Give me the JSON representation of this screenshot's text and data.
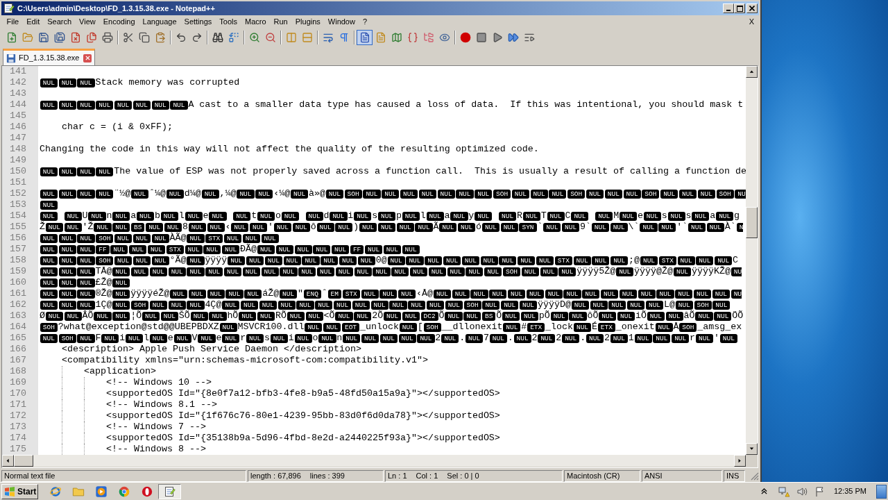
{
  "window": {
    "title": "C:\\Users\\admin\\Desktop\\FD_1.3.15.38.exe - Notepad++"
  },
  "menu": {
    "items": [
      "File",
      "Edit",
      "Search",
      "View",
      "Encoding",
      "Language",
      "Settings",
      "Tools",
      "Macro",
      "Run",
      "Plugins",
      "Window",
      "?"
    ],
    "close_document": "X"
  },
  "toolbar": {
    "groups": [
      {
        "buttons": [
          {
            "kind": "new",
            "pressed": false
          },
          {
            "kind": "open",
            "pressed": false
          },
          {
            "kind": "save",
            "pressed": false
          },
          {
            "kind": "saveall",
            "pressed": false
          },
          {
            "kind": "close",
            "pressed": false
          },
          {
            "kind": "closeall",
            "pressed": false
          },
          {
            "kind": "print",
            "pressed": false
          }
        ]
      },
      {
        "buttons": [
          {
            "kind": "cut",
            "pressed": false
          },
          {
            "kind": "copy",
            "pressed": false
          },
          {
            "kind": "paste",
            "pressed": false
          }
        ]
      },
      {
        "buttons": [
          {
            "kind": "undo",
            "pressed": false
          },
          {
            "kind": "redo",
            "pressed": false
          }
        ]
      },
      {
        "buttons": [
          {
            "kind": "find",
            "pressed": false
          },
          {
            "kind": "replace",
            "pressed": false
          }
        ]
      },
      {
        "buttons": [
          {
            "kind": "zoomin",
            "pressed": false
          },
          {
            "kind": "zoomout",
            "pressed": false
          }
        ]
      },
      {
        "buttons": [
          {
            "kind": "syncv",
            "pressed": false
          },
          {
            "kind": "synch",
            "pressed": false
          }
        ]
      },
      {
        "buttons": [
          {
            "kind": "wrap",
            "pressed": false
          },
          {
            "kind": "allchars",
            "pressed": false
          }
        ]
      },
      {
        "buttons": [
          {
            "kind": "indentguide",
            "pressed": true
          },
          {
            "kind": "language",
            "pressed": false
          },
          {
            "kind": "docmap",
            "pressed": false
          },
          {
            "kind": "functions",
            "pressed": false
          },
          {
            "kind": "workspace",
            "pressed": false
          },
          {
            "kind": "monitor",
            "pressed": false
          }
        ]
      },
      {
        "buttons": [
          {
            "kind": "record",
            "pressed": false
          },
          {
            "kind": "stop",
            "pressed": false
          },
          {
            "kind": "play",
            "pressed": false
          },
          {
            "kind": "playmulti",
            "pressed": false
          },
          {
            "kind": "savemacro",
            "pressed": false
          }
        ]
      }
    ]
  },
  "tabs": [
    {
      "label": "FD_1.3.15.38.exe",
      "selected": true
    }
  ],
  "editor": {
    "lines": [
      {
        "number": "141"
      },
      {
        "number": "142",
        "parts": [
          {
            "kind": "ctrl",
            "codes": [
              "NUL",
              "NUL",
              "NUL"
            ]
          },
          {
            "kind": "text",
            "text": "Stack memory was corrupted"
          }
        ]
      },
      {
        "number": "143"
      },
      {
        "number": "144",
        "parts": [
          {
            "kind": "ctrl",
            "codes": [
              "NUL",
              "NUL",
              "NUL",
              "NUL",
              "NUL",
              "NUL",
              "NUL",
              "NUL"
            ]
          },
          {
            "kind": "text",
            "text": "A cast to a smaller data type has caused a loss of data.  If this was intentional, you should mask t"
          }
        ]
      },
      {
        "number": "145"
      },
      {
        "number": "146",
        "parts": [
          {
            "kind": "text",
            "text": "    char c = (i & 0xFF);"
          }
        ]
      },
      {
        "number": "147"
      },
      {
        "number": "148",
        "parts": [
          {
            "kind": "text",
            "text": "Changing the code in this way will not affect the quality of the resulting optimized code."
          }
        ]
      },
      {
        "number": "149"
      },
      {
        "number": "150",
        "parts": [
          {
            "kind": "ctrl",
            "codes": [
              "NUL",
              "NUL",
              "NUL",
              "NUL"
            ]
          },
          {
            "kind": "text",
            "text": "The value of ESP was not properly saved across a function call.  This is usually a result of calling a function de"
          }
        ]
      },
      {
        "number": "151"
      },
      {
        "number": "152",
        "parts": [
          {
            "kind": "ctrl",
            "codes": [
              "NUL",
              "NUL",
              "NUL",
              "NUL"
            ]
          },
          {
            "kind": "text",
            "text": "¨½@"
          },
          {
            "kind": "ctrl",
            "codes": [
              "NUL"
            ]
          },
          {
            "kind": "text",
            "text": "ˆ¼@"
          },
          {
            "kind": "ctrl",
            "codes": [
              "NUL"
            ]
          },
          {
            "kind": "text",
            "text": "d¼@"
          },
          {
            "kind": "ctrl",
            "codes": [
              "NUL"
            ]
          },
          {
            "kind": "text",
            "text": ",¼@"
          },
          {
            "kind": "ctrl",
            "codes": [
              "NUL",
              "NUL"
            ]
          },
          {
            "kind": "text",
            "text": "‹¼@"
          },
          {
            "kind": "ctrl",
            "codes": [
              "NUL"
            ]
          },
          {
            "kind": "text",
            "text": "à»@"
          },
          {
            "kind": "ctrl",
            "codes": [
              "NUL",
              "SOH",
              "NUL",
              "NUL",
              "NUL",
              "NUL",
              "NUL",
              "NUL",
              "NUL",
              "SOH",
              "NUL",
              "NUL",
              "NUL",
              "SOH",
              "NUL",
              "NUL",
              "NUL",
              "SOH",
              "NUL",
              "NUL",
              "NUL",
              "SOH"
            ]
          },
          {
            "kind": "ctrl_cut",
            "codes": [
              "NU"
            ]
          }
        ]
      },
      {
        "number": "153",
        "parts": [
          {
            "kind": "ctrl",
            "codes": [
              "NUL"
            ]
          }
        ]
      },
      {
        "number": "154",
        "parts": [
          {
            "kind": "ctrl",
            "codes": [
              "NUL"
            ]
          },
          {
            "kind": "space"
          },
          {
            "kind": "ctrl",
            "codes": [
              "NUL"
            ]
          },
          {
            "kind": "text",
            "text": "U"
          },
          {
            "kind": "ctrl",
            "codes": [
              "NUL"
            ]
          },
          {
            "kind": "text",
            "text": "n"
          },
          {
            "kind": "ctrl",
            "codes": [
              "NUL"
            ]
          },
          {
            "kind": "text",
            "text": "a"
          },
          {
            "kind": "ctrl",
            "codes": [
              "NUL"
            ]
          },
          {
            "kind": "text",
            "text": "b"
          },
          {
            "kind": "ctrl",
            "codes": [
              "NUL"
            ]
          },
          {
            "kind": "text",
            "text": "l"
          },
          {
            "kind": "ctrl",
            "codes": [
              "NUL"
            ]
          },
          {
            "kind": "text",
            "text": "e"
          },
          {
            "kind": "ctrl",
            "codes": [
              "NUL"
            ]
          },
          {
            "kind": "space"
          },
          {
            "kind": "ctrl",
            "codes": [
              "NUL"
            ]
          },
          {
            "kind": "text",
            "text": "t"
          },
          {
            "kind": "ctrl",
            "codes": [
              "NUL"
            ]
          },
          {
            "kind": "text",
            "text": "o"
          },
          {
            "kind": "ctrl",
            "codes": [
              "NUL"
            ]
          },
          {
            "kind": "space"
          },
          {
            "kind": "ctrl",
            "codes": [
              "NUL"
            ]
          },
          {
            "kind": "text",
            "text": "d"
          },
          {
            "kind": "ctrl",
            "codes": [
              "NUL"
            ]
          },
          {
            "kind": "text",
            "text": "i"
          },
          {
            "kind": "ctrl",
            "codes": [
              "NUL"
            ]
          },
          {
            "kind": "text",
            "text": "s"
          },
          {
            "kind": "ctrl",
            "codes": [
              "NUL"
            ]
          },
          {
            "kind": "text",
            "text": "p"
          },
          {
            "kind": "ctrl",
            "codes": [
              "NUL"
            ]
          },
          {
            "kind": "text",
            "text": "l"
          },
          {
            "kind": "ctrl",
            "codes": [
              "NUL"
            ]
          },
          {
            "kind": "text",
            "text": "a"
          },
          {
            "kind": "ctrl",
            "codes": [
              "NUL"
            ]
          },
          {
            "kind": "text",
            "text": "y"
          },
          {
            "kind": "ctrl",
            "codes": [
              "NUL"
            ]
          },
          {
            "kind": "space"
          },
          {
            "kind": "ctrl",
            "codes": [
              "NUL"
            ]
          },
          {
            "kind": "text",
            "text": "R"
          },
          {
            "kind": "ctrl",
            "codes": [
              "NUL"
            ]
          },
          {
            "kind": "text",
            "text": "T"
          },
          {
            "kind": "ctrl",
            "codes": [
              "NUL"
            ]
          },
          {
            "kind": "text",
            "text": "C"
          },
          {
            "kind": "ctrl",
            "codes": [
              "NUL"
            ]
          },
          {
            "kind": "space"
          },
          {
            "kind": "ctrl",
            "codes": [
              "NUL"
            ]
          },
          {
            "kind": "text",
            "text": "M"
          },
          {
            "kind": "ctrl",
            "codes": [
              "NUL"
            ]
          },
          {
            "kind": "text",
            "text": "e"
          },
          {
            "kind": "ctrl",
            "codes": [
              "NUL"
            ]
          },
          {
            "kind": "text",
            "text": "s"
          },
          {
            "kind": "ctrl",
            "codes": [
              "NUL"
            ]
          },
          {
            "kind": "text",
            "text": "s"
          },
          {
            "kind": "ctrl",
            "codes": [
              "NUL"
            ]
          },
          {
            "kind": "text",
            "text": "a"
          },
          {
            "kind": "ctrl",
            "codes": [
              "NUL"
            ]
          },
          {
            "kind": "text",
            "text": "g"
          }
        ]
      },
      {
        "number": "155",
        "parts": [
          {
            "kind": "text",
            "text": "Ž"
          },
          {
            "kind": "ctrl",
            "codes": [
              "NUL",
              "NUL"
            ]
          },
          {
            "kind": "text",
            "text": "'Ž"
          },
          {
            "kind": "ctrl",
            "codes": [
              "NUL",
              "NUL",
              "BS",
              "NUL",
              "NUL"
            ]
          },
          {
            "kind": "text",
            "text": "8"
          },
          {
            "kind": "ctrl",
            "codes": [
              "NUL",
              "NUL"
            ]
          },
          {
            "kind": "text",
            "text": "‹"
          },
          {
            "kind": "ctrl",
            "codes": [
              "NUL",
              "NUL"
            ]
          },
          {
            "kind": "text",
            "text": "'"
          },
          {
            "kind": "ctrl",
            "codes": [
              "NUL",
              "NUL"
            ]
          },
          {
            "kind": "text",
            "text": "ô"
          },
          {
            "kind": "ctrl",
            "codes": [
              "NUL",
              "NUL"
            ]
          },
          {
            "kind": "text",
            "text": ")"
          },
          {
            "kind": "ctrl",
            "codes": [
              "NUL",
              "NUL",
              "NUL",
              "NUL"
            ]
          },
          {
            "kind": "text",
            "text": "Ã"
          },
          {
            "kind": "ctrl",
            "codes": [
              "NUL",
              "NUL"
            ]
          },
          {
            "kind": "text",
            "text": "ó"
          },
          {
            "kind": "ctrl",
            "codes": [
              "NUL",
              "NUL",
              "SYN"
            ]
          },
          {
            "kind": "text",
            "text": "`"
          },
          {
            "kind": "ctrl",
            "codes": [
              "NUL",
              "NUL"
            ]
          },
          {
            "kind": "text",
            "text": "9`"
          },
          {
            "kind": "ctrl",
            "codes": [
              "NUL",
              "NUL"
            ]
          },
          {
            "kind": "text",
            "text": "\\`"
          },
          {
            "kind": "ctrl",
            "codes": [
              "NUL",
              "NUL"
            ]
          },
          {
            "kind": "text",
            "text": "'`"
          },
          {
            "kind": "ctrl",
            "codes": [
              "NUL",
              "NUL"
            ]
          },
          {
            "kind": "text",
            "text": "À`"
          },
          {
            "kind": "ctrl_cut",
            "codes": [
              "N"
            ]
          }
        ]
      },
      {
        "number": "156",
        "parts": [
          {
            "kind": "ctrl",
            "codes": [
              "NUL",
              "NUL",
              "NUL",
              "SOH",
              "NUL",
              "NUL",
              "NUL"
            ]
          },
          {
            "kind": "text",
            "text": "ÀÃ@"
          },
          {
            "kind": "ctrl",
            "codes": [
              "NUL",
              "STX",
              "NUL",
              "NUL",
              "NUL"
            ]
          }
        ]
      },
      {
        "number": "157",
        "parts": [
          {
            "kind": "ctrl",
            "codes": [
              "NUL",
              "NUL",
              "NUL",
              "FF",
              "NUL",
              "NUL",
              "NUL",
              "STX",
              "NUL",
              "NUL",
              "NUL"
            ]
          },
          {
            "kind": "text",
            "text": "ÐÃ@"
          },
          {
            "kind": "ctrl",
            "codes": [
              "NUL",
              "NUL",
              "NUL",
              "NUL",
              "NUL",
              "FF",
              "NUL",
              "NUL",
              "NUL"
            ]
          }
        ]
      },
      {
        "number": "158",
        "parts": [
          {
            "kind": "ctrl",
            "codes": [
              "NUL",
              "NUL",
              "NUL",
              "SOH",
              "NUL",
              "NUL",
              "NUL"
            ]
          },
          {
            "kind": "text",
            "text": "°Ã@"
          },
          {
            "kind": "ctrl",
            "codes": [
              "NUL"
            ]
          },
          {
            "kind": "text",
            "text": "ÿÿÿÿ"
          },
          {
            "kind": "ctrl",
            "codes": [
              "NUL",
              "NUL",
              "NUL",
              "NUL",
              "NUL",
              "NUL",
              "NUL",
              "NUL"
            ]
          },
          {
            "kind": "text",
            "text": "0@"
          },
          {
            "kind": "ctrl",
            "codes": [
              "NUL",
              "NUL",
              "NUL",
              "NUL",
              "NUL",
              "NUL",
              "NUL",
              "NUL",
              "NUL",
              "STX",
              "NUL",
              "NUL",
              "NUL"
            ]
          },
          {
            "kind": "text",
            "text": ";@"
          },
          {
            "kind": "ctrl",
            "codes": [
              "NUL",
              "STX",
              "NUL",
              "NUL",
              "NUL"
            ]
          },
          {
            "kind": "text",
            "text": "C"
          }
        ]
      },
      {
        "number": "159",
        "parts": [
          {
            "kind": "ctrl",
            "codes": [
              "NUL",
              "NUL",
              "NUL"
            ]
          },
          {
            "kind": "text",
            "text": "TÅ@"
          },
          {
            "kind": "ctrl",
            "codes": [
              "NUL",
              "NUL",
              "NUL",
              "NUL",
              "NUL",
              "NUL",
              "NUL",
              "NUL",
              "NUL",
              "NUL",
              "NUL",
              "NUL",
              "NUL",
              "NUL",
              "NUL",
              "NUL",
              "NUL",
              "NUL",
              "NUL",
              "NUL",
              "NUL",
              "SOH",
              "NUL",
              "NUL",
              "NUL"
            ]
          },
          {
            "kind": "text",
            "text": "ÿÿÿÿ5Ž@"
          },
          {
            "kind": "ctrl",
            "codes": [
              "NUL"
            ]
          },
          {
            "kind": "text",
            "text": "ÿÿÿÿ@Ž@"
          },
          {
            "kind": "ctrl",
            "codes": [
              "NUL"
            ]
          },
          {
            "kind": "text",
            "text": "ÿÿÿÿKŽ@"
          },
          {
            "kind": "ctrl_cut",
            "codes": [
              "NU"
            ]
          }
        ]
      },
      {
        "number": "160",
        "parts": [
          {
            "kind": "ctrl",
            "codes": [
              "NUL",
              "NUL",
              "NUL"
            ]
          },
          {
            "kind": "text",
            "text": "£Ž@"
          },
          {
            "kind": "ctrl",
            "codes": [
              "NUL"
            ]
          }
        ]
      },
      {
        "number": "161",
        "parts": [
          {
            "kind": "ctrl",
            "codes": [
              "NUL",
              "NUL",
              "NUL"
            ]
          },
          {
            "kind": "text",
            "text": "®Ž@"
          },
          {
            "kind": "ctrl",
            "codes": [
              "NUL"
            ]
          },
          {
            "kind": "text",
            "text": "ÿÿÿÿéŽ@"
          },
          {
            "kind": "ctrl",
            "codes": [
              "NUL",
              "NUL",
              "NUL",
              "NUL",
              "NUL"
            ]
          },
          {
            "kind": "text",
            "text": "áŽ@"
          },
          {
            "kind": "ctrl",
            "codes": [
              "NUL"
            ]
          },
          {
            "kind": "text",
            "text": "\""
          },
          {
            "kind": "ctrl",
            "codes": [
              "ENQ"
            ]
          },
          {
            "kind": "text",
            "text": "ˆ"
          },
          {
            "kind": "ctrl",
            "codes": [
              "EM",
              "STX",
              "NUL",
              "NUL",
              "NUL"
            ]
          },
          {
            "kind": "text",
            "text": "‹Å@"
          },
          {
            "kind": "ctrl",
            "codes": [
              "NUL",
              "NUL",
              "NUL",
              "NUL",
              "NUL",
              "NUL",
              "NUL",
              "NUL",
              "NUL",
              "NUL",
              "NUL",
              "NUL",
              "NUL",
              "NUL",
              "NUL",
              "NUL"
            ]
          },
          {
            "kind": "ctrl_cut",
            "codes": [
              "NU"
            ]
          }
        ]
      },
      {
        "number": "162",
        "parts": [
          {
            "kind": "ctrl",
            "codes": [
              "NUL",
              "NUL",
              "NUL"
            ]
          },
          {
            "kind": "text",
            "text": "1Ç@"
          },
          {
            "kind": "ctrl",
            "codes": [
              "NUL",
              "SOH",
              "NUL",
              "NUL",
              "NUL"
            ]
          },
          {
            "kind": "text",
            "text": "4Ç@"
          },
          {
            "kind": "ctrl",
            "codes": [
              "NUL",
              "NUL",
              "NUL",
              "NUL",
              "NUL",
              "NUL",
              "NUL",
              "NUL",
              "NUL",
              "NUL",
              "NUL",
              "NUL",
              "NUL",
              "SOH",
              "NUL",
              "NUL",
              "NUL"
            ]
          },
          {
            "kind": "text",
            "text": "ÿÿÿÿD@"
          },
          {
            "kind": "ctrl",
            "codes": [
              "NUL",
              "NUL",
              "NUL",
              "NUL",
              "NUL"
            ]
          },
          {
            "kind": "text",
            "text": "L@"
          },
          {
            "kind": "ctrl",
            "codes": [
              "NUL",
              "SOH",
              "NUL"
            ]
          }
        ]
      },
      {
        "number": "163",
        "parts": [
          {
            "kind": "text",
            "text": "Ø"
          },
          {
            "kind": "ctrl",
            "codes": [
              "NUL",
              "NUL"
            ]
          },
          {
            "kind": "text",
            "text": "ÂÕ"
          },
          {
            "kind": "ctrl",
            "codes": [
              "NUL",
              "NUL"
            ]
          },
          {
            "kind": "text",
            "text": "¦Õ"
          },
          {
            "kind": "ctrl",
            "codes": [
              "NUL",
              "NUL"
            ]
          },
          {
            "kind": "text",
            "text": "ŠÕ"
          },
          {
            "kind": "ctrl",
            "codes": [
              "NUL",
              "NUL"
            ]
          },
          {
            "kind": "text",
            "text": "hÕ"
          },
          {
            "kind": "ctrl",
            "codes": [
              "NUL",
              "NUL"
            ]
          },
          {
            "kind": "text",
            "text": "RÕ"
          },
          {
            "kind": "ctrl",
            "codes": [
              "NUL",
              "NUL"
            ]
          },
          {
            "kind": "text",
            "text": "<Õ"
          },
          {
            "kind": "ctrl",
            "codes": [
              "NUL",
              "NUL"
            ]
          },
          {
            "kind": "text",
            "text": "2Õ"
          },
          {
            "kind": "ctrl",
            "codes": [
              "NUL",
              "NUL",
              "DC2"
            ]
          },
          {
            "kind": "text",
            "text": "Õ"
          },
          {
            "kind": "ctrl",
            "codes": [
              "NUL",
              "NUL",
              "BS"
            ]
          },
          {
            "kind": "text",
            "text": "Õ"
          },
          {
            "kind": "ctrl",
            "codes": [
              "NUL",
              "NUL"
            ]
          },
          {
            "kind": "text",
            "text": "pÕ"
          },
          {
            "kind": "ctrl",
            "codes": [
              "NUL",
              "NUL"
            ]
          },
          {
            "kind": "text",
            "text": "ôÕ"
          },
          {
            "kind": "ctrl",
            "codes": [
              "NUL",
              "NUL"
            ]
          },
          {
            "kind": "text",
            "text": "iÕ"
          },
          {
            "kind": "ctrl",
            "codes": [
              "NUL",
              "NUL"
            ]
          },
          {
            "kind": "text",
            "text": "âÕ"
          },
          {
            "kind": "ctrl",
            "codes": [
              "NUL",
              "NUL"
            ]
          },
          {
            "kind": "text",
            "text": "ÖÕ"
          }
        ]
      },
      {
        "number": "164",
        "parts": [
          {
            "kind": "ctrl",
            "codes": [
              "SOH"
            ]
          },
          {
            "kind": "text",
            "text": "?what@exception@std@@UBEPBDXZ"
          },
          {
            "kind": "ctrl",
            "codes": [
              "NUL"
            ]
          },
          {
            "kind": "text",
            "text": "MSVCR100.dll"
          },
          {
            "kind": "ctrl",
            "codes": [
              "NUL",
              "NUL",
              "EOT"
            ]
          },
          {
            "kind": "text",
            "text": "_unlock"
          },
          {
            "kind": "ctrl",
            "codes": [
              "NUL"
            ]
          },
          {
            "kind": "text",
            "text": "["
          },
          {
            "kind": "ctrl",
            "codes": [
              "SOH"
            ]
          },
          {
            "kind": "text",
            "text": "__dllonexit"
          },
          {
            "kind": "ctrl",
            "codes": [
              "NUL"
            ]
          },
          {
            "kind": "text",
            "text": "#"
          },
          {
            "kind": "ctrl",
            "codes": [
              "ETX"
            ]
          },
          {
            "kind": "text",
            "text": "_lock"
          },
          {
            "kind": "ctrl",
            "codes": [
              "NUL"
            ]
          },
          {
            "kind": "text",
            "text": "É"
          },
          {
            "kind": "ctrl",
            "codes": [
              "ETX"
            ]
          },
          {
            "kind": "text",
            "text": "_onexit"
          },
          {
            "kind": "ctrl",
            "codes": [
              "NUL"
            ]
          },
          {
            "kind": "text",
            "text": "Å"
          },
          {
            "kind": "ctrl",
            "codes": [
              "SOH"
            ]
          },
          {
            "kind": "text",
            "text": "_amsg_ex"
          }
        ]
      },
      {
        "number": "165",
        "parts": [
          {
            "kind": "ctrl",
            "codes": [
              "NUL",
              "SOH",
              "NUL"
            ]
          },
          {
            "kind": "text",
            "text": "F"
          },
          {
            "kind": "ctrl",
            "codes": [
              "NUL"
            ]
          },
          {
            "kind": "text",
            "text": "i"
          },
          {
            "kind": "ctrl",
            "codes": [
              "NUL"
            ]
          },
          {
            "kind": "text",
            "text": "l"
          },
          {
            "kind": "ctrl",
            "codes": [
              "NUL"
            ]
          },
          {
            "kind": "text",
            "text": "e"
          },
          {
            "kind": "ctrl",
            "codes": [
              "NUL"
            ]
          },
          {
            "kind": "text",
            "text": "V"
          },
          {
            "kind": "ctrl",
            "codes": [
              "NUL"
            ]
          },
          {
            "kind": "text",
            "text": "e"
          },
          {
            "kind": "ctrl",
            "codes": [
              "NUL"
            ]
          },
          {
            "kind": "text",
            "text": "r"
          },
          {
            "kind": "ctrl",
            "codes": [
              "NUL"
            ]
          },
          {
            "kind": "text",
            "text": "s"
          },
          {
            "kind": "ctrl",
            "codes": [
              "NUL"
            ]
          },
          {
            "kind": "text",
            "text": "i"
          },
          {
            "kind": "ctrl",
            "codes": [
              "NUL"
            ]
          },
          {
            "kind": "text",
            "text": "o"
          },
          {
            "kind": "ctrl",
            "codes": [
              "NUL"
            ]
          },
          {
            "kind": "text",
            "text": "n"
          },
          {
            "kind": "ctrl",
            "codes": [
              "NUL",
              "NUL",
              "NUL",
              "NUL",
              "NUL"
            ]
          },
          {
            "kind": "text",
            "text": "2"
          },
          {
            "kind": "ctrl",
            "codes": [
              "NUL"
            ]
          },
          {
            "kind": "text",
            "text": "."
          },
          {
            "kind": "ctrl",
            "codes": [
              "NUL"
            ]
          },
          {
            "kind": "text",
            "text": "7"
          },
          {
            "kind": "ctrl",
            "codes": [
              "NUL"
            ]
          },
          {
            "kind": "text",
            "text": "."
          },
          {
            "kind": "ctrl",
            "codes": [
              "NUL"
            ]
          },
          {
            "kind": "text",
            "text": "2"
          },
          {
            "kind": "ctrl",
            "codes": [
              "NUL"
            ]
          },
          {
            "kind": "text",
            "text": "2"
          },
          {
            "kind": "ctrl",
            "codes": [
              "NUL"
            ]
          },
          {
            "kind": "text",
            "text": "."
          },
          {
            "kind": "ctrl",
            "codes": [
              "NUL"
            ]
          },
          {
            "kind": "text",
            "text": "2"
          },
          {
            "kind": "ctrl",
            "codes": [
              "NUL"
            ]
          },
          {
            "kind": "text",
            "text": "1"
          },
          {
            "kind": "ctrl",
            "codes": [
              "NUL",
              "NUL",
              "NUL"
            ]
          },
          {
            "kind": "text",
            "text": "r"
          },
          {
            "kind": "ctrl",
            "codes": [
              "NUL"
            ]
          },
          {
            "kind": "text",
            "text": "'"
          },
          {
            "kind": "ctrl",
            "codes": [
              "NUL"
            ]
          }
        ]
      },
      {
        "number": "166",
        "parts": [
          {
            "kind": "text",
            "text": "    <description> Apple Push Service Daemon </description>"
          }
        ]
      },
      {
        "number": "167",
        "parts": [
          {
            "kind": "text",
            "text": "    <compatibility xmlns=\"urn:schemas-microsoft-com:compatibility.v1\">"
          }
        ]
      },
      {
        "number": "168",
        "parts": [
          {
            "kind": "text",
            "text": "        <application>"
          }
        ]
      },
      {
        "number": "169",
        "parts": [
          {
            "kind": "text",
            "text": "            <!-- Windows 10 -->"
          }
        ]
      },
      {
        "number": "170",
        "parts": [
          {
            "kind": "text",
            "text": "            <supportedOS Id=\"{8e0f7a12-bfb3-4fe8-b9a5-48fd50a15a9a}\"></supportedOS>"
          }
        ]
      },
      {
        "number": "171",
        "parts": [
          {
            "kind": "text",
            "text": "            <!-- Windows 8.1 -->"
          }
        ]
      },
      {
        "number": "172",
        "parts": [
          {
            "kind": "text",
            "text": "            <supportedOS Id=\"{1f676c76-80e1-4239-95bb-83d0f6d0da78}\"></supportedOS>"
          }
        ]
      },
      {
        "number": "173",
        "parts": [
          {
            "kind": "text",
            "text": "            <!-- Windows 7 -->"
          }
        ]
      },
      {
        "number": "174",
        "parts": [
          {
            "kind": "text",
            "text": "            <supportedOS Id=\"{35138b9a-5d96-4fbd-8e2d-a2440225f93a}\"></supportedOS>"
          }
        ]
      },
      {
        "number": "175",
        "parts": [
          {
            "kind": "text",
            "text": "            <!-- Windows 8 -->"
          }
        ]
      }
    ]
  },
  "status_bar": {
    "panels": [
      {
        "texts": [
          "Normal text file"
        ]
      },
      {
        "texts": [
          "length : 67,896",
          "lines : 399"
        ]
      },
      {
        "texts": [
          "Ln : 1",
          "Col : 1",
          "Sel : 0 | 0"
        ]
      },
      {
        "texts": [
          "Macintosh (CR)"
        ]
      },
      {
        "texts": [
          "ANSI"
        ]
      },
      {
        "texts": [
          "INS"
        ]
      }
    ]
  },
  "taskbar": {
    "start": "Start",
    "apps": [
      {
        "kind": "ie",
        "selected": false
      },
      {
        "kind": "explorer",
        "selected": false
      },
      {
        "kind": "media",
        "selected": false
      },
      {
        "kind": "chrome",
        "selected": false
      },
      {
        "kind": "opera",
        "selected": false
      },
      {
        "kind": "notepad",
        "selected": true
      }
    ],
    "clock": "12:35 PM"
  }
}
